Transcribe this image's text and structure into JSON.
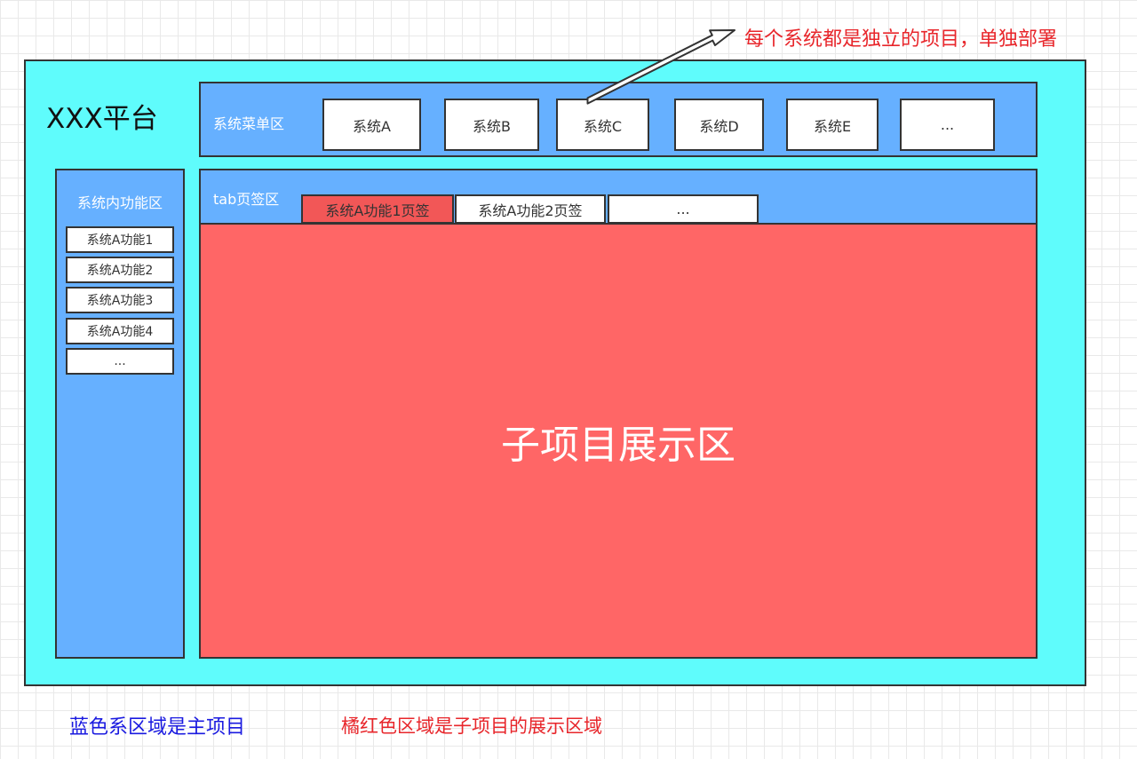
{
  "annotation_top": "每个系统都是独立的项目，单独部署",
  "platform": {
    "title": "XXX平台"
  },
  "menu_bar": {
    "label": "系统菜单区",
    "systems": [
      "系统A",
      "系统B",
      "系统C",
      "系统D",
      "系统E",
      "..."
    ]
  },
  "function_panel": {
    "label": "系统内功能区",
    "items": [
      "系统A功能1",
      "系统A功能2",
      "系统A功能3",
      "系统A功能4",
      "..."
    ]
  },
  "tab_bar": {
    "label": "tab页签区",
    "tabs": [
      "系统A功能1页签",
      "系统A功能2页签",
      "..."
    ],
    "active_index": 0
  },
  "display_area": {
    "title": "子项目展示区"
  },
  "legend": {
    "blue": "蓝色系区域是主项目",
    "red": "橘红色区域是子项目的展示区域"
  },
  "colors": {
    "platform_bg": "#5ffcfc",
    "panel_blue": "#66b0ff",
    "display_red": "#ff6666",
    "active_tab": "#f25757",
    "annotation_red": "#e8262b",
    "legend_blue": "#1a1ae0"
  }
}
